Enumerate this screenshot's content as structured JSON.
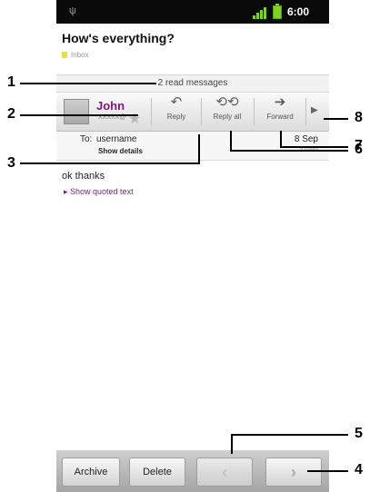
{
  "status_bar": {
    "time": "6:00"
  },
  "message": {
    "subject": "How's everything?",
    "label": "Inbox",
    "read_messages": "2 read messages",
    "sender": "John",
    "sender_address": "XXXXX@",
    "to_label": "To:",
    "to_value": "username",
    "show_details": "Show details",
    "date": "8 Sep",
    "time": "5:09am",
    "body": "ok thanks",
    "show_quoted": "▸ Show quoted text"
  },
  "toolbar": {
    "reply": "Reply",
    "reply_all": "Reply all",
    "forward": "Forward"
  },
  "bottom_bar": {
    "archive": "Archive",
    "delete": "Delete"
  },
  "callouts": [
    "1",
    "2",
    "3",
    "4",
    "5",
    "6",
    "7",
    "8"
  ],
  "icons": [
    "usb-icon",
    "signal-icon",
    "battery-icon",
    "label-icon",
    "avatar-icon",
    "star-icon",
    "reply-icon",
    "reply-all-icon",
    "forward-icon",
    "more-icon",
    "previous-arrow-icon",
    "next-arrow-icon"
  ]
}
